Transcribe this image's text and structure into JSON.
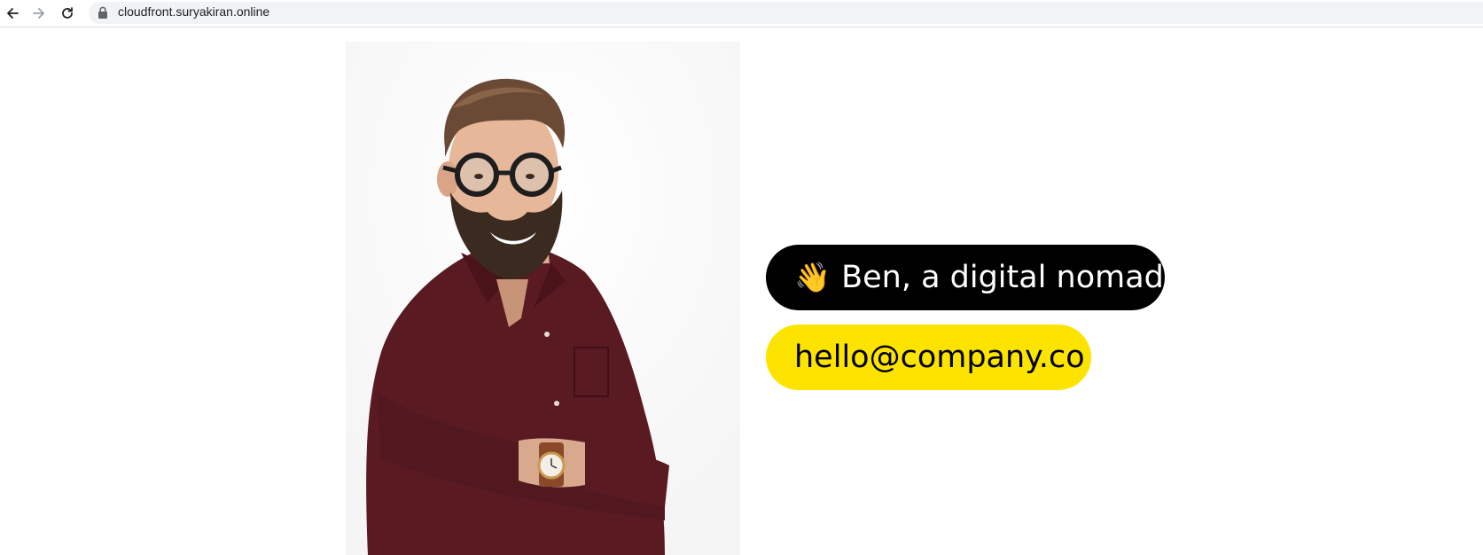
{
  "browser": {
    "url": "cloudfront.suryakiran.online",
    "back_icon": "arrow-left-icon",
    "forward_icon": "arrow-right-icon",
    "reload_icon": "reload-icon",
    "lock_icon": "lock-icon"
  },
  "profile": {
    "photo_description_icon": "portrait-photo",
    "wave_emoji": "👋",
    "intro_text": "Ben, a digital nomad",
    "email": "hello@company.co"
  },
  "colors": {
    "name_pill_bg": "#000000",
    "name_pill_text": "#ffffff",
    "email_pill_bg": "#fde400",
    "email_pill_text": "#000000",
    "shirt": "#5a1a22",
    "hair": "#6b4a35",
    "skin": "#e6b899"
  }
}
